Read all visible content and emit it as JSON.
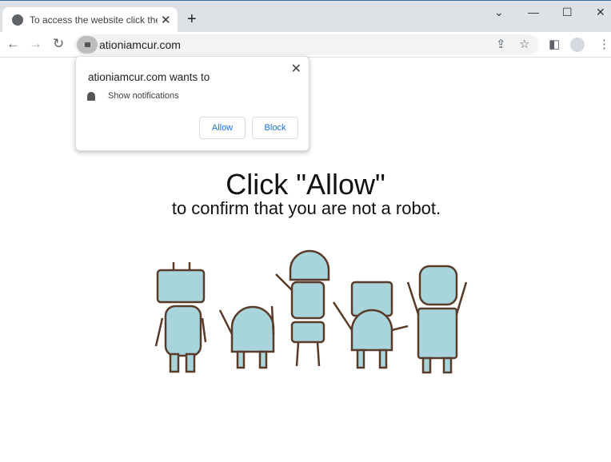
{
  "browser": {
    "tab_title": "To access the website click the \"Allow\"",
    "url": "ationiamcur.com"
  },
  "popup": {
    "title": "ationiamcur.com wants to",
    "permission": "Show notifications",
    "allow": "Allow",
    "block": "Block"
  },
  "page": {
    "heading": "Click \"Allow\"",
    "subheading": "to confirm that you are not a robot."
  },
  "colors": {
    "robot_fill": "#a8d4dc",
    "robot_outline": "#5a3a28",
    "button_text": "#1a73e8"
  }
}
